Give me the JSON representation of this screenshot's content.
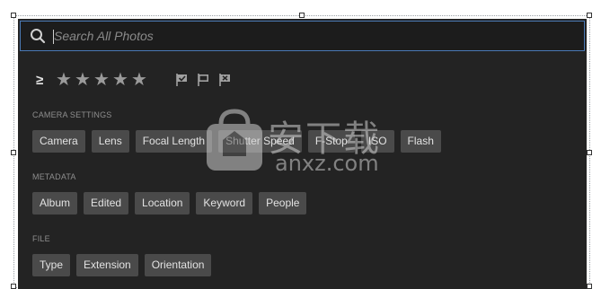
{
  "search": {
    "placeholder": "Search All Photos",
    "value": ""
  },
  "rating": {
    "operator": "≥",
    "stars": [
      "★",
      "★",
      "★",
      "★",
      "★"
    ],
    "flags": [
      "flagged-icon",
      "unflagged-icon",
      "rejected-icon"
    ]
  },
  "sections": {
    "camera": {
      "label": "CAMERA SETTINGS",
      "chips": [
        "Camera",
        "Lens",
        "Focal Length",
        "Shutter Speed",
        "F-Stop",
        "ISO",
        "Flash"
      ]
    },
    "metadata": {
      "label": "METADATA",
      "chips": [
        "Album",
        "Edited",
        "Location",
        "Keyword",
        "People"
      ]
    },
    "file": {
      "label": "FILE",
      "chips": [
        "Type",
        "Extension",
        "Orientation"
      ]
    }
  },
  "watermark": {
    "cn": "安下载",
    "en": "anxz.com"
  },
  "colors": {
    "panel": "#232323",
    "chip": "#4a4a4a",
    "focus_border": "#4a79b5"
  }
}
